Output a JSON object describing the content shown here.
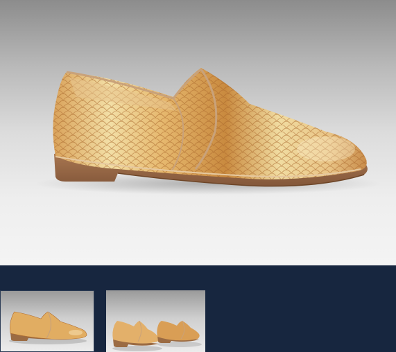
{
  "viewer": {
    "main_image": {
      "icon": "loafer-shoe-photo",
      "subject": "snakeskin-loafer"
    },
    "thumbnails": [
      {
        "icon": "loafer-side-thumbnail",
        "selected": true
      },
      {
        "icon": "loafer-pair-thumbnail",
        "selected": false
      }
    ]
  },
  "colors": {
    "strip_background": "#17263f",
    "leather_light": "#f1dca1",
    "leather_mid": "#d79a4e",
    "leather_dark": "#b06b2c",
    "sole": "#9b6b43"
  }
}
